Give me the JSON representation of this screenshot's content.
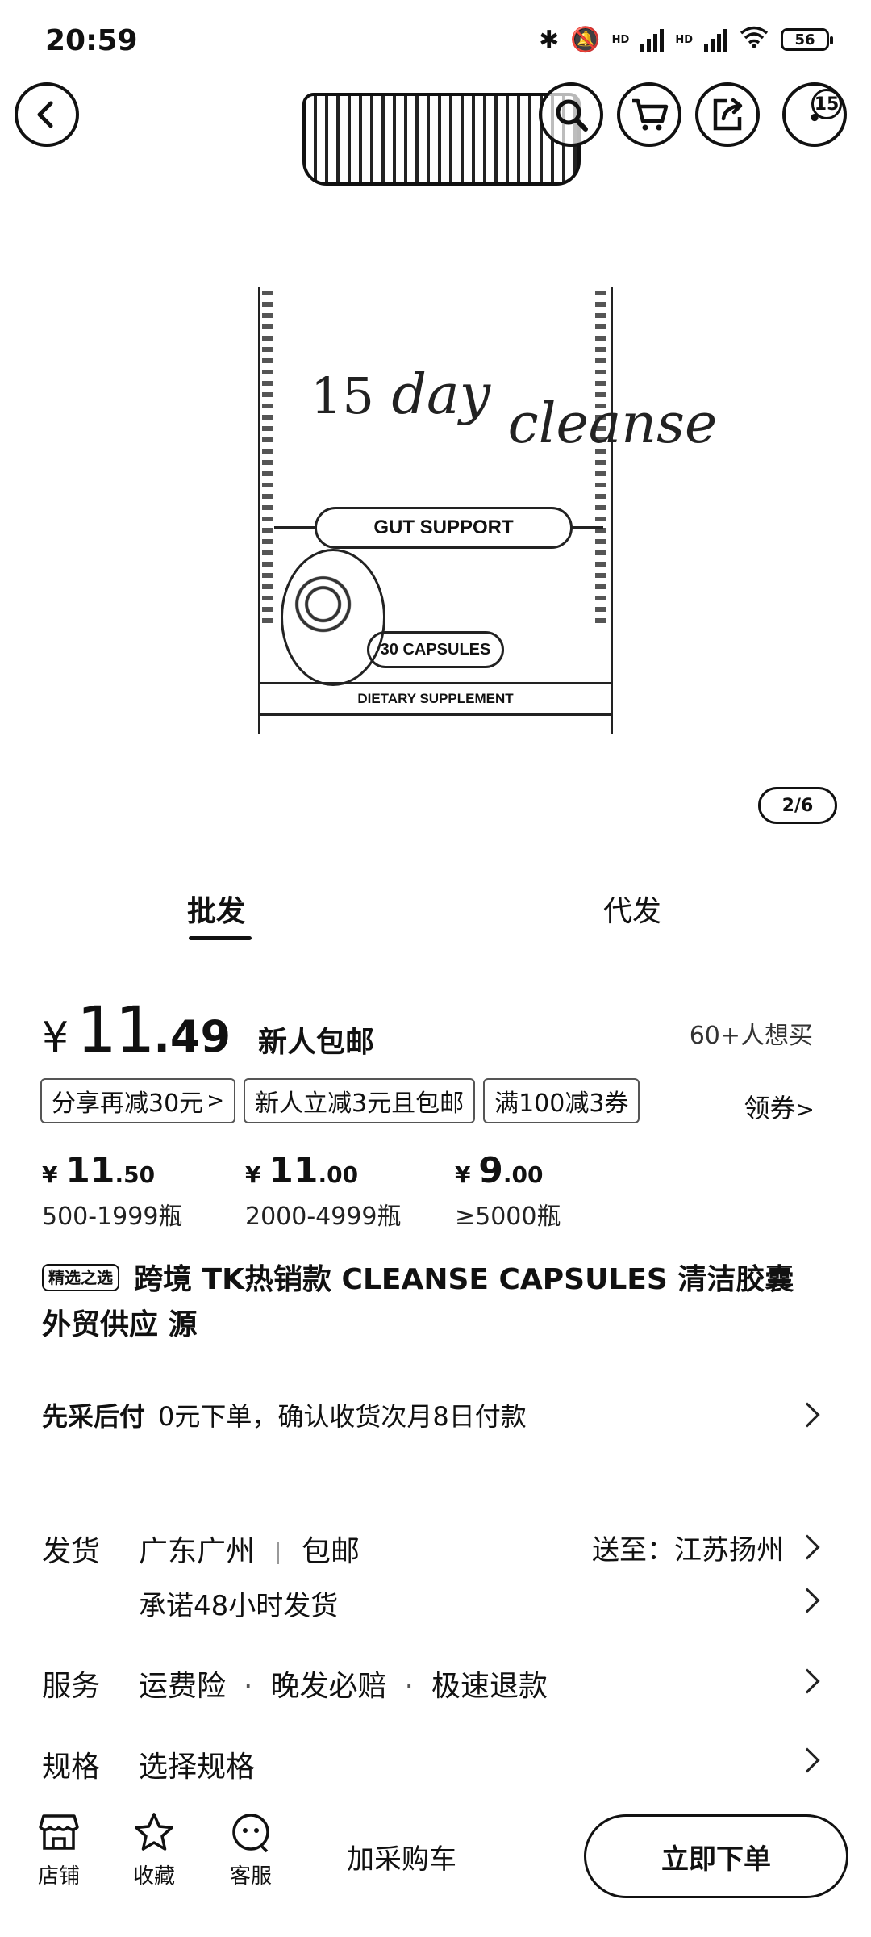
{
  "status_bar": {
    "time": "20:59",
    "battery": "56",
    "network_label": "HD"
  },
  "gallery": {
    "page_indicator": "2/6",
    "cart_badge": "15",
    "product_image": {
      "brand_number": "15",
      "brand_day": "day",
      "brand_cleanse": "cleanse",
      "label_gut": "GUT SUPPORT",
      "label_caps": "30 CAPSULES",
      "label_supplement": "DIETARY SUPPLEMENT"
    }
  },
  "tabs": {
    "wholesale": "批发",
    "dropship": "代发"
  },
  "price": {
    "currency": "¥",
    "integer": "11",
    "decimal": ".49",
    "free_shipping": "新人包邮",
    "want_count": "60+人想买"
  },
  "coupons": [
    "分享再减30元",
    "新人立减3元且包邮",
    "满100减3券"
  ],
  "get_coupon": "领券",
  "tiers": [
    {
      "currency": "¥",
      "int": "11",
      "dec": ".50",
      "qty": "500-1999瓶"
    },
    {
      "currency": "¥",
      "int": "11",
      "dec": ".00",
      "qty": "2000-4999瓶"
    },
    {
      "currency": "¥",
      "int": "9",
      "dec": ".00",
      "qty": "≥5000瓶"
    }
  ],
  "title": {
    "tag": "精选之选",
    "text": "跨境 TK热销款 CLEANSE CAPSULES 清洁胶囊 外贸供应 源"
  },
  "pay_later": {
    "key": "先采后付",
    "value": "0元下单，确认收货次月8日付款"
  },
  "shipping": {
    "label": "发货",
    "origin": "广东广州",
    "free": "包邮",
    "promise": "承诺48小时发货",
    "ship_to": "送至：江苏扬州"
  },
  "service": {
    "label": "服务",
    "items": [
      "运费险",
      "晚发必赔",
      "极速退款"
    ]
  },
  "spec": {
    "label": "规格",
    "value": "选择规格"
  },
  "bottom_bar": {
    "shop": "店铺",
    "favorite": "收藏",
    "service": "客服",
    "add_cart": "加采购车",
    "buy_now": "立即下单"
  }
}
